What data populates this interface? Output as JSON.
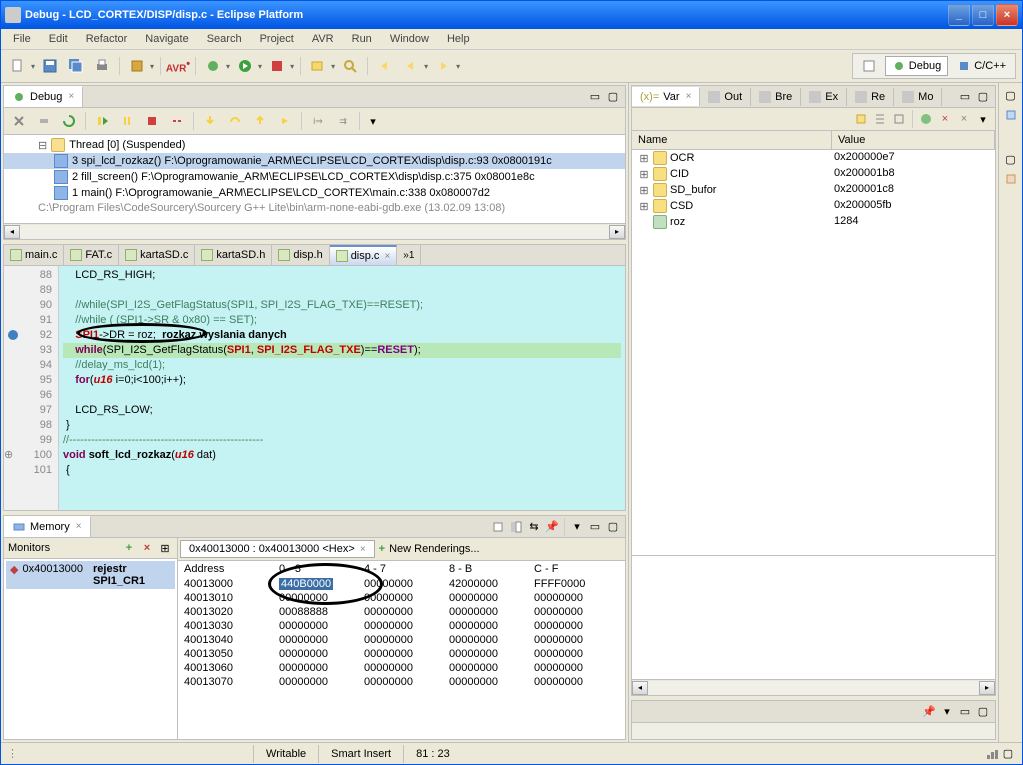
{
  "title": "Debug - LCD_CORTEX/DISP/disp.c - Eclipse Platform",
  "menu": [
    "File",
    "Edit",
    "Refactor",
    "Navigate",
    "Search",
    "Project",
    "AVR",
    "Run",
    "Window",
    "Help"
  ],
  "perspectives": {
    "debug": "Debug",
    "cpp": "C/C++"
  },
  "debug_view": {
    "tab": "Debug",
    "thread": "Thread [0] (Suspended)",
    "frames": [
      "3 spi_lcd_rozkaz() F:\\Oprogramowanie_ARM\\ECLIPSE\\LCD_CORTEX\\disp\\disp.c:93 0x0800191c",
      "2 fill_screen() F:\\Oprogramowanie_ARM\\ECLIPSE\\LCD_CORTEX\\disp\\disp.c:375 0x08001e8c",
      "1 main() F:\\Oprogramowanie_ARM\\ECLIPSE\\LCD_CORTEX\\main.c:338 0x080007d2"
    ],
    "gdb": "C:\\Program Files\\CodeSourcery\\Sourcery G++ Lite\\bin\\arm-none-eabi-gdb.exe (13.02.09 13:08)"
  },
  "editor": {
    "tabs": [
      "main.c",
      "FAT.c",
      "kartaSD.c",
      "kartaSD.h",
      "disp.h",
      "disp.c"
    ],
    "more": "»1",
    "lines": [
      {
        "n": 88,
        "t": "    LCD_RS_HIGH;"
      },
      {
        "n": 89,
        "t": ""
      },
      {
        "n": 90,
        "t": "    //while(SPI_I2S_GetFlagStatus(SPI1, SPI_I2S_FLAG_TXE)==RESET);",
        "cmt": true
      },
      {
        "n": 91,
        "t": "    //while ( (SPI1->SR & 0x80) == SET);",
        "cmt": true
      },
      {
        "n": 92,
        "t": "    SPI1->DR = roz;  rozkaz wyslania danych",
        "special": "spi"
      },
      {
        "n": 93,
        "t": "    while(SPI_I2S_GetFlagStatus(SPI1, SPI_I2S_FLAG_TXE)==RESET);",
        "hl": true,
        "special": "while"
      },
      {
        "n": 94,
        "t": "    //delay_ms_lcd(1);",
        "cmt": true
      },
      {
        "n": 95,
        "t": "    for(u16 i=0;i<100;i++);",
        "special": "for"
      },
      {
        "n": 96,
        "t": ""
      },
      {
        "n": 97,
        "t": "    LCD_RS_LOW;"
      },
      {
        "n": 98,
        "t": " }"
      },
      {
        "n": 99,
        "t": "//-----------------------------------------------------",
        "cmt": true
      },
      {
        "n": 100,
        "t": "void soft_lcd_rozkaz(u16 dat)",
        "special": "func",
        "expand": true
      },
      {
        "n": 101,
        "t": " {"
      }
    ]
  },
  "vars": {
    "tab": "Var",
    "tabs_other": [
      "Out",
      "Bre",
      "Ex",
      "Re",
      "Mo"
    ],
    "headers": {
      "name": "Name",
      "value": "Value"
    },
    "rows": [
      {
        "name": "OCR",
        "value": "0x200000e7",
        "exp": true
      },
      {
        "name": "CID",
        "value": "0x200001b8",
        "exp": true
      },
      {
        "name": "SD_bufor",
        "value": "0x200001c8",
        "exp": true
      },
      {
        "name": "CSD",
        "value": "0x200005fb",
        "exp": true
      },
      {
        "name": "roz",
        "value": "1284",
        "simple": true
      }
    ]
  },
  "memory": {
    "tab": "Memory",
    "monitors_label": "Monitors",
    "monitor": "0x40013000",
    "monitor_label": "rejestr SPI1_CR1",
    "rendering_tab": "0x40013000 : 0x40013000 <Hex>",
    "new_rendering": "New Renderings...",
    "headers": [
      "Address",
      "0 - 3",
      "4 - 7",
      "8 - B",
      "C - F"
    ],
    "rows": [
      {
        "addr": "40013000",
        "c0": "440B0000",
        "c1": "00000000",
        "c2": "42000000",
        "c3": "FFFF0000",
        "hl": 0
      },
      {
        "addr": "40013010",
        "c0": "00000000",
        "c1": "00000000",
        "c2": "00000000",
        "c3": "00000000"
      },
      {
        "addr": "40013020",
        "c0": "00088888",
        "c1": "00000000",
        "c2": "00000000",
        "c3": "00000000"
      },
      {
        "addr": "40013030",
        "c0": "00000000",
        "c1": "00000000",
        "c2": "00000000",
        "c3": "00000000"
      },
      {
        "addr": "40013040",
        "c0": "00000000",
        "c1": "00000000",
        "c2": "00000000",
        "c3": "00000000"
      },
      {
        "addr": "40013050",
        "c0": "00000000",
        "c1": "00000000",
        "c2": "00000000",
        "c3": "00000000"
      },
      {
        "addr": "40013060",
        "c0": "00000000",
        "c1": "00000000",
        "c2": "00000000",
        "c3": "00000000"
      },
      {
        "addr": "40013070",
        "c0": "00000000",
        "c1": "00000000",
        "c2": "00000000",
        "c3": "00000000"
      }
    ]
  },
  "status": {
    "writable": "Writable",
    "insert": "Smart Insert",
    "pos": "81 : 23"
  }
}
